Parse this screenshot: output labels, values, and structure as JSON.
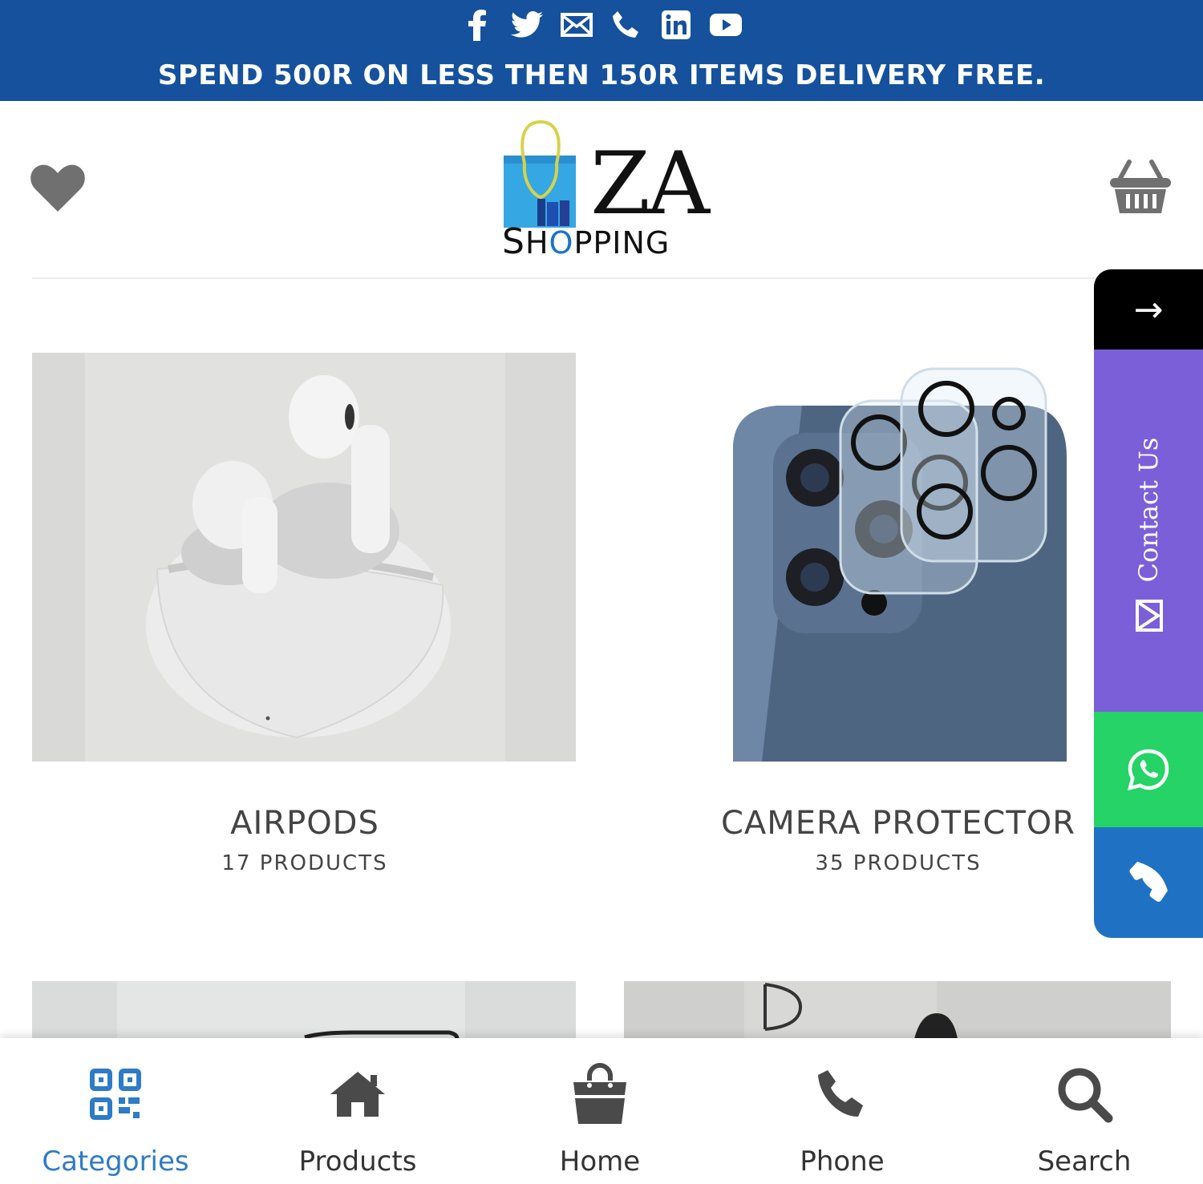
{
  "topbar": {
    "social_icons": [
      "facebook-icon",
      "twitter-icon",
      "email-icon",
      "phone-icon",
      "linkedin-icon",
      "youtube-icon"
    ],
    "promo_text": "SPEND 500R ON LESS THEN 150R ITEMS DELIVERY FREE.",
    "color": "#15519d"
  },
  "header": {
    "logo_big": "ZA",
    "logo_small_s": "S",
    "logo_small_h": "H",
    "logo_small_o": "O",
    "logo_small_rest": "PPING",
    "wishlist_icon": "heart-icon",
    "cart_icon": "basket-icon"
  },
  "categories": [
    {
      "name": "AIRPODS",
      "count": "17 PRODUCTS"
    },
    {
      "name": "CAMERA PROTECTOR",
      "count": "35 PRODUCTS"
    }
  ],
  "side_panel": {
    "arrow": "→",
    "contact_label": "Contact Us",
    "colors": {
      "arrow": "#000000",
      "contact": "#7b5fd9",
      "whatsapp": "#25d366",
      "phone": "#1f72c3"
    }
  },
  "bottom_nav": {
    "items": [
      {
        "label": "Categories",
        "icon": "qr-grid-icon",
        "active": true
      },
      {
        "label": "Products",
        "icon": "home-icon",
        "active": false
      },
      {
        "label": "Home",
        "icon": "shopping-bag-icon",
        "active": false
      },
      {
        "label": "Phone",
        "icon": "phone-icon",
        "active": false
      },
      {
        "label": "Search",
        "icon": "search-icon",
        "active": false
      }
    ],
    "active_color": "#2e7bc6"
  }
}
